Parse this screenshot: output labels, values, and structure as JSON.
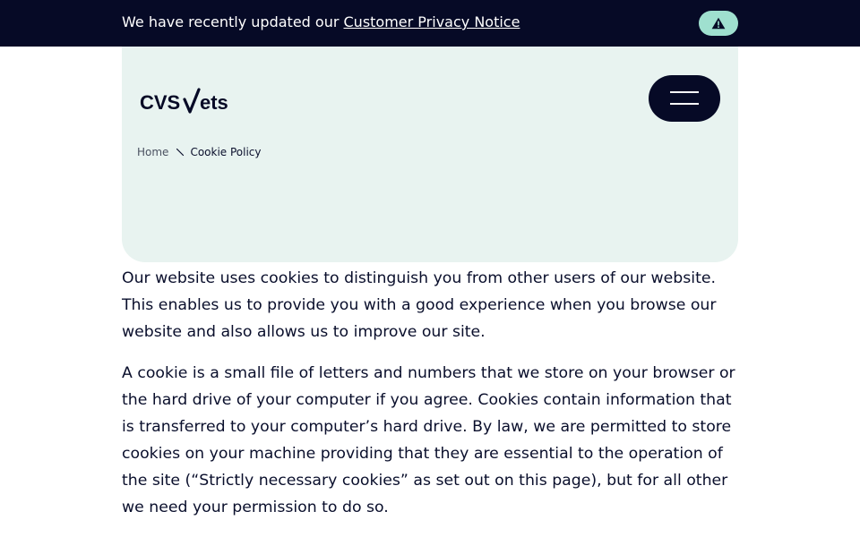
{
  "notice": {
    "text": "We have recently updated our",
    "link_text": "Customer Privacy Notice",
    "alert_icon": "warning-triangle-icon"
  },
  "header": {
    "logo_text": "CVS Vets",
    "menu_icon": "hamburger-icon"
  },
  "breadcrumb": {
    "home": "Home",
    "separator_icon": "backslash-separator-icon",
    "current": "Cookie Policy"
  },
  "content": {
    "paragraphs": [
      "Our website uses cookies to distinguish you from other users of our website. This enables us to provide you with a good experience when you browse our website and also allows us to improve our site.",
      "A cookie is a small file of letters and numbers that we store on your browser or the hard drive of your computer if you agree. Cookies contain information that is transferred to your computer’s hard drive. By law, we are permitted to store cookies on your machine providing that they are essential to the operation of the site (“Strictly necessary cookies” as set out on this page), but for all other we need your permission to do so."
    ]
  },
  "colors": {
    "navy": "#060a26",
    "hero_bg": "#e8f3f0",
    "mint": "#9fe0cf"
  }
}
